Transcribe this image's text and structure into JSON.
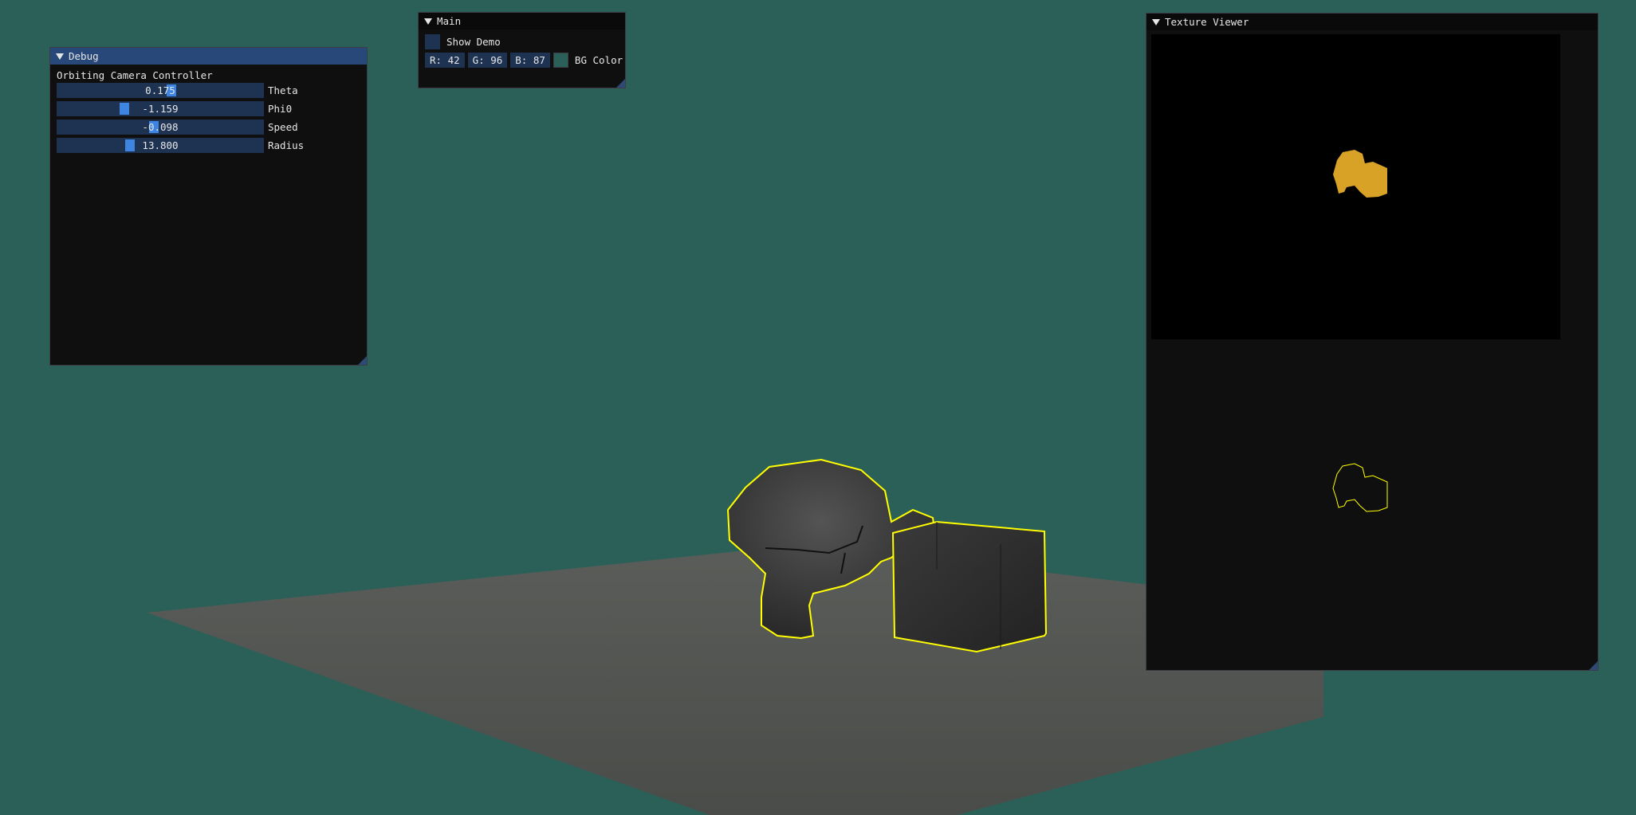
{
  "scene": {
    "background_color": "#2a6057",
    "selection_outline_color": "#ffff00",
    "mask_color": "#d7a225"
  },
  "debug": {
    "title": "Debug",
    "section_label": "Orbiting Camera Controller",
    "sliders": [
      {
        "value": "0.175",
        "label": "Theta",
        "grab_fraction": 0.42
      },
      {
        "value": "-1.159",
        "label": "Phi0",
        "grab_fraction": 0.31
      },
      {
        "value": "-0.098",
        "label": "Speed",
        "grab_fraction": 0.45
      },
      {
        "value": "13.800",
        "label": "Radius",
        "grab_fraction": 0.33
      }
    ]
  },
  "main": {
    "title": "Main",
    "checkbox_label": "Show Demo",
    "checkbox_checked": false,
    "r": "R: 42",
    "g": "G: 96",
    "b": "B: 87",
    "color_label": "BG Color",
    "swatch_color": "#2a6057"
  },
  "texture_viewer": {
    "title": "Texture Viewer"
  }
}
